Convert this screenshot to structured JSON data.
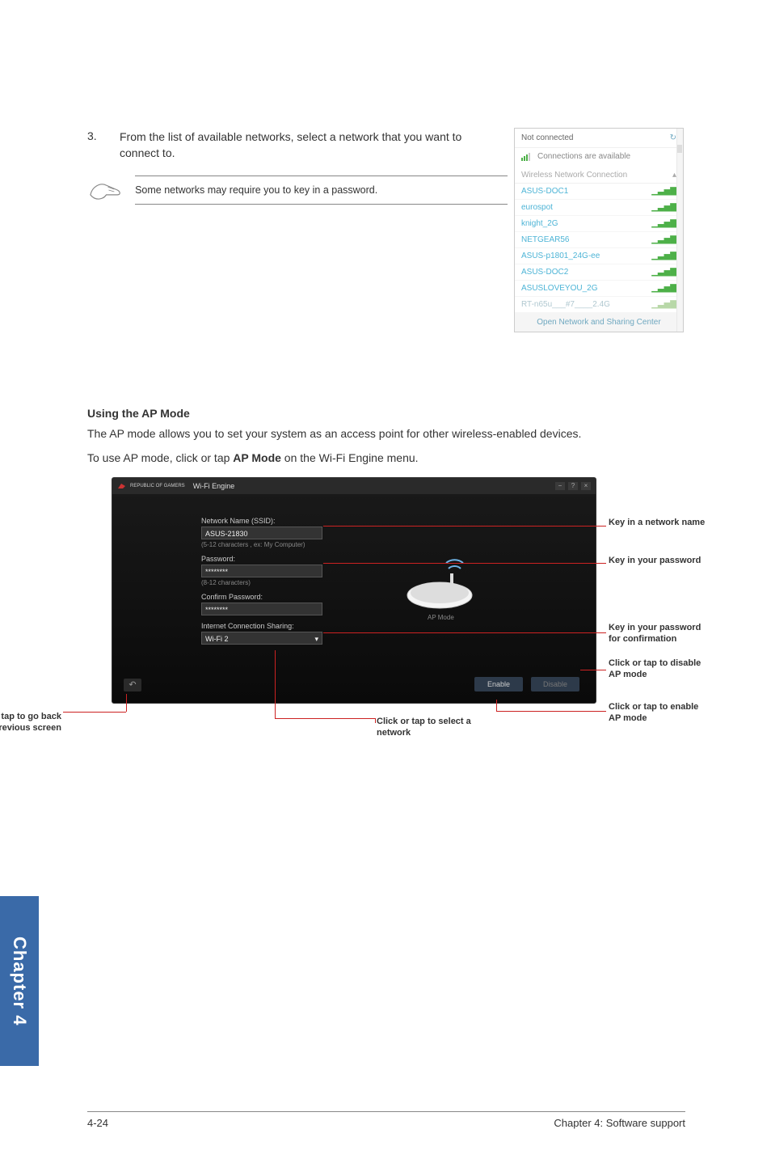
{
  "step": {
    "num": "3.",
    "text": "From the list of available networks, select a network that you want to connect to."
  },
  "note": {
    "text": "Some networks may require you to key in a password."
  },
  "net_popup": {
    "not_connected": "Not connected",
    "connections_available": "Connections are available",
    "section_label": "Wireless Network Connection",
    "items": [
      "ASUS-DOC1",
      "eurospot",
      "knight_2G",
      "NETGEAR56",
      "ASUS-p1801_24G-ee",
      "ASUS-DOC2",
      "ASUSLOVEYOU_2G",
      "RT-n65u___#7____2.4G"
    ],
    "footer": "Open Network and Sharing Center"
  },
  "ap_section": {
    "heading": "Using the AP Mode",
    "desc": "The AP mode allows you to set your system as an access point for other wireless-enabled devices.",
    "instr_pre": "To use AP mode, click or tap ",
    "instr_bold": "AP Mode",
    "instr_post": " on the Wi-Fi Engine menu."
  },
  "engine": {
    "titlebar_brand": "REPUBLIC OF GAMERS",
    "titlebar_title": "Wi-Fi Engine",
    "ssid_label": "Network Name (SSID):",
    "ssid_value": "ASUS-21830",
    "ssid_hint": "(5-12 characters , ex: My Computer)",
    "pw_label": "Password:",
    "pw_value": "********",
    "pw_hint": "(8-12 characters)",
    "confirm_label": "Confirm Password:",
    "confirm_value": "********",
    "share_label": "Internet Connection Sharing:",
    "share_value": "Wi-Fi 2",
    "ap_mode_label": "AP Mode",
    "enable_btn": "Enable",
    "disable_btn": "Disable"
  },
  "callouts": {
    "name": "Key in a network name",
    "password": "Key in your password",
    "confirm": "Key in your password for confirmation",
    "disable": "Click or tap to disable AP mode",
    "enable": "Click or tap to enable AP mode",
    "back": "Click or tap to go back to previous screen",
    "select": "Click or tap to select a network"
  },
  "side_tab": "Chapter 4",
  "footer": {
    "left": "4-24",
    "right": "Chapter 4: Software support"
  }
}
